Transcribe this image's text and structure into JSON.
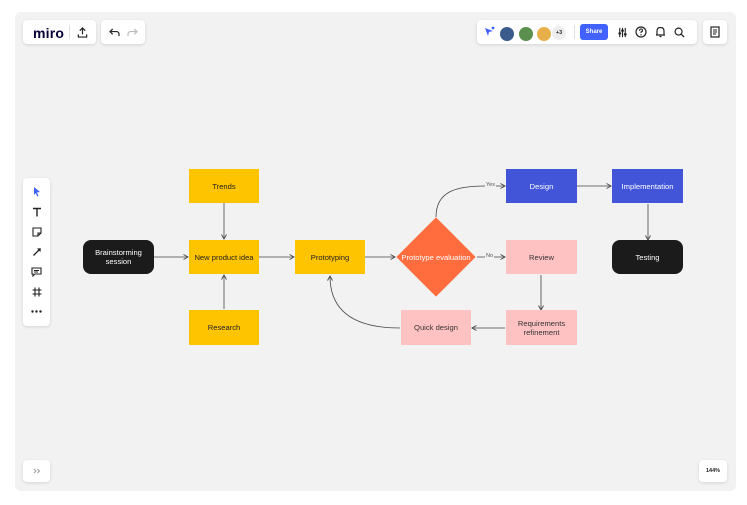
{
  "app": {
    "logo": "miro"
  },
  "toolbar": {
    "share_label": "Share",
    "more_collaborators": "+3"
  },
  "zoom": {
    "level": "144%"
  },
  "colors": {
    "accent": "#4262ff",
    "yellow": "#ffc400",
    "blue": "#4255d9",
    "pink": "#ffc2c2",
    "orange": "#ff6c3d",
    "black": "#1b1b1b"
  },
  "icons": {
    "top_left": [
      "upload-icon",
      "undo-icon",
      "redo-icon"
    ],
    "top_right": [
      "cursor-follow-icon",
      "settings-sliders-icon",
      "help-icon",
      "notifications-icon",
      "search-icon",
      "notes-icon"
    ],
    "left_tools": [
      "select-tool-icon",
      "text-tool-icon",
      "sticky-note-icon",
      "line-tool-icon",
      "comment-icon",
      "frame-icon",
      "more-icon"
    ],
    "bottom_left": [
      "expand-panel-icon"
    ]
  },
  "diagram": {
    "nodes": {
      "brainstorming": "Brainstorming session",
      "trends": "Trends",
      "new_product_idea": "New product idea",
      "research": "Research",
      "prototyping": "Prototyping",
      "prototype_evaluation": "Prototype evaluation",
      "design": "Design",
      "implementation": "Implementation",
      "testing": "Testing",
      "review": "Review",
      "requirements_refinement": "Requirements refinement",
      "quick_design": "Quick design"
    },
    "edge_labels": {
      "yes": "Yes",
      "no": "No"
    }
  }
}
